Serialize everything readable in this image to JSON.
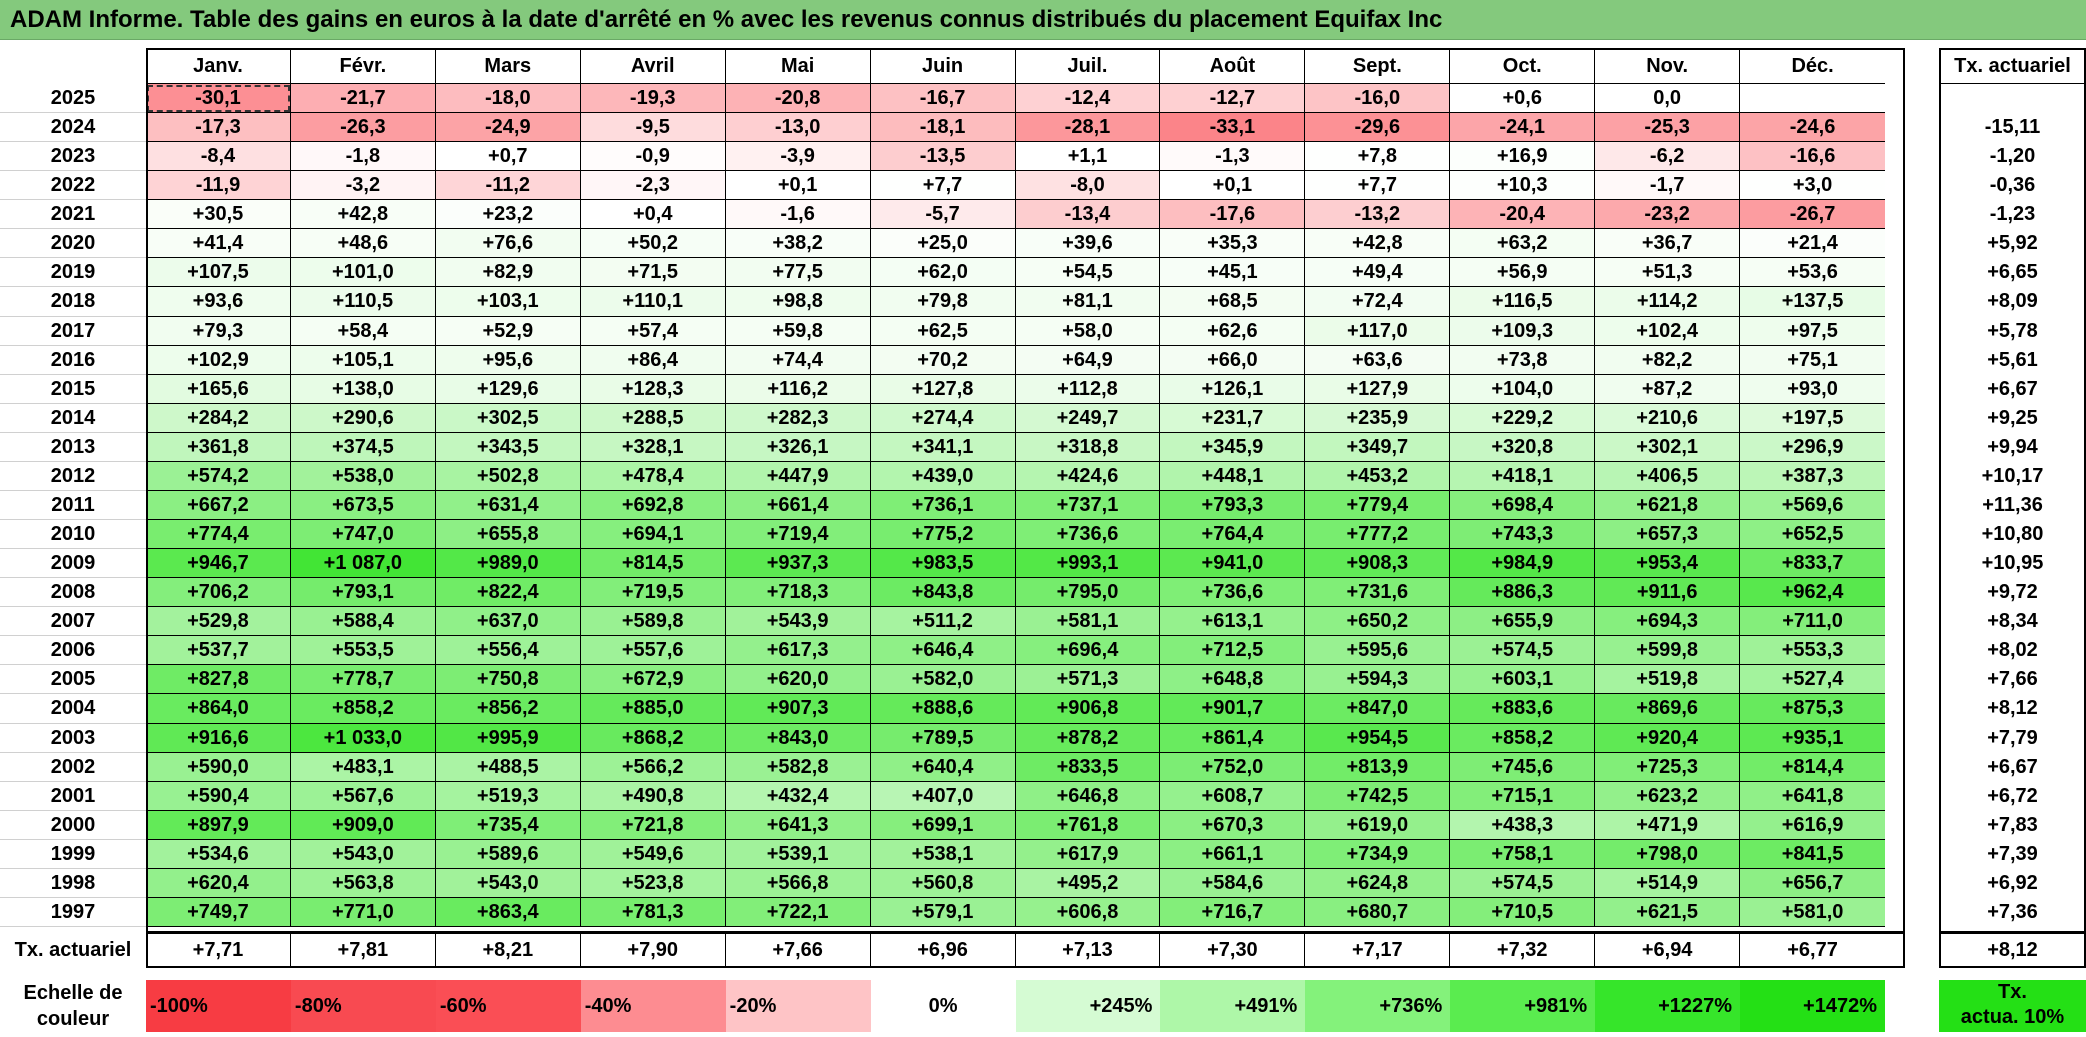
{
  "title": "ADAM Informe. Table des gains en euros à la date d'arrêté en % avec les revenus connus distribués du placement Equifax Inc",
  "months": [
    "Janv.",
    "Févr.",
    "Mars",
    "Avril",
    "Mai",
    "Juin",
    "Juil.",
    "Août",
    "Sept.",
    "Oct.",
    "Nov.",
    "Déc."
  ],
  "tx_header": "Tx. actuariel",
  "rows": [
    {
      "year": "2025",
      "values": [
        "-30,1",
        "-21,7",
        "-18,0",
        "-19,3",
        "-20,8",
        "-16,7",
        "-12,4",
        "-12,7",
        "-16,0",
        "+0,6",
        "0,0",
        ""
      ],
      "tx": ""
    },
    {
      "year": "2024",
      "values": [
        "-17,3",
        "-26,3",
        "-24,9",
        "-9,5",
        "-13,0",
        "-18,1",
        "-28,1",
        "-33,1",
        "-29,6",
        "-24,1",
        "-25,3",
        "-24,6"
      ],
      "tx": "-15,11"
    },
    {
      "year": "2023",
      "values": [
        "-8,4",
        "-1,8",
        "+0,7",
        "-0,9",
        "-3,9",
        "-13,5",
        "+1,1",
        "-1,3",
        "+7,8",
        "+16,9",
        "-6,2",
        "-16,6"
      ],
      "tx": "-1,20"
    },
    {
      "year": "2022",
      "values": [
        "-11,9",
        "-3,2",
        "-11,2",
        "-2,3",
        "+0,1",
        "+7,7",
        "-8,0",
        "+0,1",
        "+7,7",
        "+10,3",
        "-1,7",
        "+3,0"
      ],
      "tx": "-0,36"
    },
    {
      "year": "2021",
      "values": [
        "+30,5",
        "+42,8",
        "+23,2",
        "+0,4",
        "-1,6",
        "-5,7",
        "-13,4",
        "-17,6",
        "-13,2",
        "-20,4",
        "-23,2",
        "-26,7"
      ],
      "tx": "-1,23"
    },
    {
      "year": "2020",
      "values": [
        "+41,4",
        "+48,6",
        "+76,6",
        "+50,2",
        "+38,2",
        "+25,0",
        "+39,6",
        "+35,3",
        "+42,8",
        "+63,2",
        "+36,7",
        "+21,4"
      ],
      "tx": "+5,92"
    },
    {
      "year": "2019",
      "values": [
        "+107,5",
        "+101,0",
        "+82,9",
        "+71,5",
        "+77,5",
        "+62,0",
        "+54,5",
        "+45,1",
        "+49,4",
        "+56,9",
        "+51,3",
        "+53,6"
      ],
      "tx": "+6,65"
    },
    {
      "year": "2018",
      "values": [
        "+93,6",
        "+110,5",
        "+103,1",
        "+110,1",
        "+98,8",
        "+79,8",
        "+81,1",
        "+68,5",
        "+72,4",
        "+116,5",
        "+114,2",
        "+137,5"
      ],
      "tx": "+8,09"
    },
    {
      "year": "2017",
      "values": [
        "+79,3",
        "+58,4",
        "+52,9",
        "+57,4",
        "+59,8",
        "+62,5",
        "+58,0",
        "+62,6",
        "+117,0",
        "+109,3",
        "+102,4",
        "+97,5"
      ],
      "tx": "+5,78"
    },
    {
      "year": "2016",
      "values": [
        "+102,9",
        "+105,1",
        "+95,6",
        "+86,4",
        "+74,4",
        "+70,2",
        "+64,9",
        "+66,0",
        "+63,6",
        "+73,8",
        "+82,2",
        "+75,1"
      ],
      "tx": "+5,61"
    },
    {
      "year": "2015",
      "values": [
        "+165,6",
        "+138,0",
        "+129,6",
        "+128,3",
        "+116,2",
        "+127,8",
        "+112,8",
        "+126,1",
        "+127,9",
        "+104,0",
        "+87,2",
        "+93,0"
      ],
      "tx": "+6,67"
    },
    {
      "year": "2014",
      "values": [
        "+284,2",
        "+290,6",
        "+302,5",
        "+288,5",
        "+282,3",
        "+274,4",
        "+249,7",
        "+231,7",
        "+235,9",
        "+229,2",
        "+210,6",
        "+197,5"
      ],
      "tx": "+9,25"
    },
    {
      "year": "2013",
      "values": [
        "+361,8",
        "+374,5",
        "+343,5",
        "+328,1",
        "+326,1",
        "+341,1",
        "+318,8",
        "+345,9",
        "+349,7",
        "+320,8",
        "+302,1",
        "+296,9"
      ],
      "tx": "+9,94"
    },
    {
      "year": "2012",
      "values": [
        "+574,2",
        "+538,0",
        "+502,8",
        "+478,4",
        "+447,9",
        "+439,0",
        "+424,6",
        "+448,1",
        "+453,2",
        "+418,1",
        "+406,5",
        "+387,3"
      ],
      "tx": "+10,17"
    },
    {
      "year": "2011",
      "values": [
        "+667,2",
        "+673,5",
        "+631,4",
        "+692,8",
        "+661,4",
        "+736,1",
        "+737,1",
        "+793,3",
        "+779,4",
        "+698,4",
        "+621,8",
        "+569,6"
      ],
      "tx": "+11,36"
    },
    {
      "year": "2010",
      "values": [
        "+774,4",
        "+747,0",
        "+655,8",
        "+694,1",
        "+719,4",
        "+775,2",
        "+736,6",
        "+764,4",
        "+777,2",
        "+743,3",
        "+657,3",
        "+652,5"
      ],
      "tx": "+10,80"
    },
    {
      "year": "2009",
      "values": [
        "+946,7",
        "+1 087,0",
        "+989,0",
        "+814,5",
        "+937,3",
        "+983,5",
        "+993,1",
        "+941,0",
        "+908,3",
        "+984,9",
        "+953,4",
        "+833,7"
      ],
      "tx": "+10,95"
    },
    {
      "year": "2008",
      "values": [
        "+706,2",
        "+793,1",
        "+822,4",
        "+719,5",
        "+718,3",
        "+843,8",
        "+795,0",
        "+736,6",
        "+731,6",
        "+886,3",
        "+911,6",
        "+962,4"
      ],
      "tx": "+9,72"
    },
    {
      "year": "2007",
      "values": [
        "+529,8",
        "+588,4",
        "+637,0",
        "+589,8",
        "+543,9",
        "+511,2",
        "+581,1",
        "+613,1",
        "+650,2",
        "+655,9",
        "+694,3",
        "+711,0"
      ],
      "tx": "+8,34"
    },
    {
      "year": "2006",
      "values": [
        "+537,7",
        "+553,5",
        "+556,4",
        "+557,6",
        "+617,3",
        "+646,4",
        "+696,4",
        "+712,5",
        "+595,6",
        "+574,5",
        "+599,8",
        "+553,3"
      ],
      "tx": "+8,02"
    },
    {
      "year": "2005",
      "values": [
        "+827,8",
        "+778,7",
        "+750,8",
        "+672,9",
        "+620,0",
        "+582,0",
        "+571,3",
        "+648,8",
        "+594,3",
        "+603,1",
        "+519,8",
        "+527,4"
      ],
      "tx": "+7,66"
    },
    {
      "year": "2004",
      "values": [
        "+864,0",
        "+858,2",
        "+856,2",
        "+885,0",
        "+907,3",
        "+888,6",
        "+906,8",
        "+901,7",
        "+847,0",
        "+883,6",
        "+869,6",
        "+875,3"
      ],
      "tx": "+8,12"
    },
    {
      "year": "2003",
      "values": [
        "+916,6",
        "+1 033,0",
        "+995,9",
        "+868,2",
        "+843,0",
        "+789,5",
        "+878,2",
        "+861,4",
        "+954,5",
        "+858,2",
        "+920,4",
        "+935,1"
      ],
      "tx": "+7,79"
    },
    {
      "year": "2002",
      "values": [
        "+590,0",
        "+483,1",
        "+488,5",
        "+566,2",
        "+582,8",
        "+640,4",
        "+833,5",
        "+752,0",
        "+813,9",
        "+745,6",
        "+725,3",
        "+814,4"
      ],
      "tx": "+6,67"
    },
    {
      "year": "2001",
      "values": [
        "+590,4",
        "+567,6",
        "+519,3",
        "+490,8",
        "+432,4",
        "+407,0",
        "+646,8",
        "+608,7",
        "+742,5",
        "+715,1",
        "+623,2",
        "+641,8"
      ],
      "tx": "+6,72"
    },
    {
      "year": "2000",
      "values": [
        "+897,9",
        "+909,0",
        "+735,4",
        "+721,8",
        "+641,3",
        "+699,1",
        "+761,8",
        "+670,3",
        "+619,0",
        "+438,3",
        "+471,9",
        "+616,9"
      ],
      "tx": "+7,83"
    },
    {
      "year": "1999",
      "values": [
        "+534,6",
        "+543,0",
        "+589,6",
        "+549,6",
        "+539,1",
        "+538,1",
        "+617,9",
        "+661,1",
        "+734,9",
        "+758,1",
        "+798,0",
        "+841,5"
      ],
      "tx": "+7,39"
    },
    {
      "year": "1998",
      "values": [
        "+620,4",
        "+563,8",
        "+543,0",
        "+523,8",
        "+566,8",
        "+560,8",
        "+495,2",
        "+584,6",
        "+624,8",
        "+574,5",
        "+514,9",
        "+656,7"
      ],
      "tx": "+6,92"
    },
    {
      "year": "1997",
      "values": [
        "+749,7",
        "+771,0",
        "+863,4",
        "+781,3",
        "+722,1",
        "+579,1",
        "+606,8",
        "+716,7",
        "+680,7",
        "+710,5",
        "+621,5",
        "+581,0"
      ],
      "tx": "+7,36"
    }
  ],
  "footer": {
    "label": "Tx. actuariel",
    "values": [
      "+7,71",
      "+7,81",
      "+8,21",
      "+7,90",
      "+7,66",
      "+6,96",
      "+7,13",
      "+7,30",
      "+7,17",
      "+7,32",
      "+6,94",
      "+6,77"
    ],
    "total": "+8,12"
  },
  "scale": {
    "label_line1": "Echelle de",
    "label_line2": "couleur",
    "items": [
      {
        "label": "-100%",
        "color": "#f73c43"
      },
      {
        "label": "-80%",
        "color": "#f84a51"
      },
      {
        "label": "-60%",
        "color": "#fa4e55"
      },
      {
        "label": "-40%",
        "color": "#fd8c91"
      },
      {
        "label": "-20%",
        "color": "#fec4c6"
      },
      {
        "label": "0%",
        "color": "#ffffff"
      },
      {
        "label": "+245%",
        "color": "#d5fbd3"
      },
      {
        "label": "+491%",
        "color": "#aef7a8"
      },
      {
        "label": "+736%",
        "color": "#84f27b"
      },
      {
        "label": "+981%",
        "color": "#5aec4f"
      },
      {
        "label": "+1227%",
        "color": "#36e52a"
      },
      {
        "label": "+1472%",
        "color": "#24e015"
      }
    ],
    "legend_line1": "Tx.",
    "legend_line2": "actua. 10%",
    "legend_color": "#24e015"
  },
  "selected_cell": {
    "year": "2025",
    "month": "Janv."
  }
}
